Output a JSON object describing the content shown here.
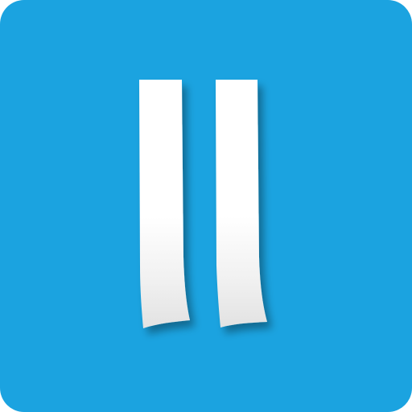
{
  "icon": {
    "semantic_name": "pause-ribbons-icon",
    "background_color": "#1BA3E0",
    "bar_color": "#FFFFFF",
    "bar_shade_color": "#E6E6E6"
  }
}
